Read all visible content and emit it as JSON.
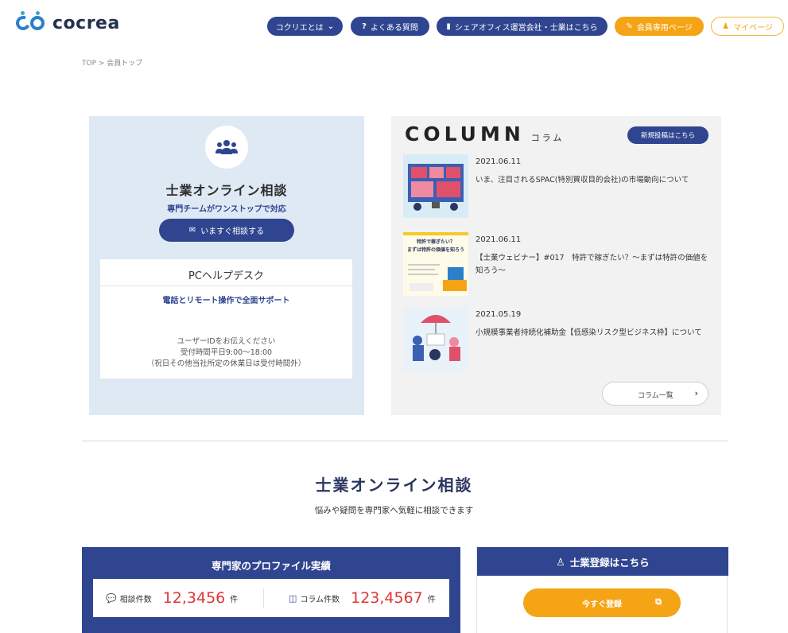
{
  "brand": {
    "name": "cocrea",
    "color": "#2b80c9"
  },
  "colors": {
    "navy": "#2f4590",
    "orange": "#f5a416",
    "panel_blue": "#dee9f4",
    "panel_gray": "#f2f2f2",
    "accent_red": "#e0353a"
  },
  "nav": {
    "about": {
      "label": "コクリエとは",
      "icon": "chevron-down-icon"
    },
    "faq": {
      "label": "よくある質問",
      "icon": "question-icon"
    },
    "office": {
      "label": "シェアオフィス運営会社・士業はこちら",
      "icon": "building-icon"
    },
    "members": {
      "label": "会員専用ページ",
      "icon": "edit-icon"
    },
    "mypage": {
      "label": "マイページ",
      "icon": "user-icon"
    }
  },
  "breadcrumb": "TOP > 会員トップ",
  "consultation": {
    "icon": "group-icon",
    "title": "士業オンライン相談",
    "subtitle": "専門チームがワンストップで対応",
    "button": "いますぐ相談する",
    "helpdesk": {
      "title": "PCヘルプデスク",
      "subtitle": "電話とリモート操作で全面サポート",
      "line1": "ユーザーIDをお伝えください",
      "line2": "受付時間平日9:00～18:00",
      "line3": "（祝日その他当社所定の休業日は受付時間外）"
    }
  },
  "column": {
    "title": "COLUMN",
    "title_jp": "コラム",
    "post_button": "新規投稿はこちら",
    "articles": [
      {
        "date": "2021.06.11",
        "title": "いま、注目されるSPAC(特別買収目的会社)の市場動向について"
      },
      {
        "date": "2021.06.11",
        "title": "【士業ウェビナー】#017　特許で稼ぎたい？～まずは特許の価値を知ろう～",
        "thumb_text1": "特許で稼ぎたい？",
        "thumb_text2": "まずは特許の価値を知ろう"
      },
      {
        "date": "2021.05.19",
        "title": "小規模事業者持続化補助金【低感染リスク型ビジネス枠】について"
      }
    ],
    "list_button": "コラム一覧"
  },
  "section": {
    "title": "士業オンライン相談",
    "subtitle": "悩みや疑問を専門家へ気軽に相談できます"
  },
  "stats": {
    "title": "専門家のプロファイル実績",
    "consult_label": "相談件数",
    "consult_value": "12,3456",
    "consult_unit": "件",
    "column_label": "コラム件数",
    "column_value": "123,4567",
    "column_unit": "件"
  },
  "register": {
    "title": "士業登録はこちら",
    "button": "今すぐ登録"
  }
}
